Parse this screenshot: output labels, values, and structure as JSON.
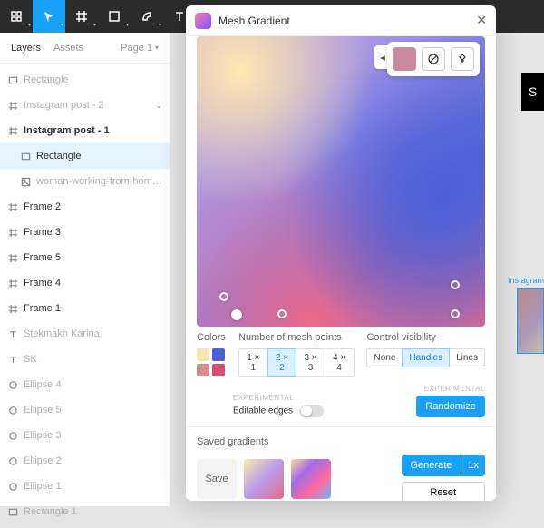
{
  "toolbar": {
    "tools": [
      "figma",
      "move",
      "frame",
      "shape",
      "pen",
      "text"
    ]
  },
  "leftPanel": {
    "tabs": [
      "Layers",
      "Assets"
    ],
    "page": "Page 1",
    "layers": [
      {
        "icon": "rect",
        "label": "Rectangle",
        "indent": 0,
        "dim": true
      },
      {
        "icon": "frame",
        "label": "Instagram post - 2",
        "indent": 0,
        "dim": true,
        "expand": true
      },
      {
        "icon": "frame",
        "label": "Instagram post - 1",
        "indent": 0,
        "bold": true
      },
      {
        "icon": "rect",
        "label": "Rectangle",
        "indent": 1,
        "sel": true
      },
      {
        "icon": "image",
        "label": "woman-working-from-home-l...",
        "indent": 1,
        "dim": true
      },
      {
        "icon": "frame",
        "label": "Frame 2",
        "indent": 0
      },
      {
        "icon": "frame",
        "label": "Frame 3",
        "indent": 0
      },
      {
        "icon": "frame",
        "label": "Frame 5",
        "indent": 0
      },
      {
        "icon": "frame",
        "label": "Frame 4",
        "indent": 0
      },
      {
        "icon": "frame",
        "label": "Frame 1",
        "indent": 0
      },
      {
        "icon": "text",
        "label": "Stekmakh Karina",
        "indent": 0,
        "dim": true
      },
      {
        "icon": "text",
        "label": "SK",
        "indent": 0,
        "dim": true
      },
      {
        "icon": "ellipse",
        "label": "Ellipse 4",
        "indent": 0,
        "dim": true
      },
      {
        "icon": "ellipse",
        "label": "Ellipse 5",
        "indent": 0,
        "dim": true
      },
      {
        "icon": "ellipse",
        "label": "Ellipse 3",
        "indent": 0,
        "dim": true
      },
      {
        "icon": "ellipse",
        "label": "Ellipse 2",
        "indent": 0,
        "dim": true
      },
      {
        "icon": "ellipse",
        "label": "Ellipse 1",
        "indent": 0,
        "dim": true
      },
      {
        "icon": "rect",
        "label": "Rectangle 1",
        "indent": 0,
        "dim": true
      }
    ]
  },
  "plugin": {
    "title": "Mesh Gradient",
    "labels": {
      "colors": "Colors",
      "meshPoints": "Number of mesh points",
      "visibility": "Control visibility",
      "experimental": "EXPERIMENTAL",
      "editableEdges": "Editable edges",
      "randomize": "Randomize",
      "saved": "Saved gradients",
      "save": "Save",
      "generate": "Generate",
      "genCount": "1x",
      "reset": "Reset"
    },
    "swatches": [
      "#f5e6b3",
      "#4d5fd6",
      "#d98b8b",
      "#d9506e"
    ],
    "meshOptions": [
      "1 × 1",
      "2 × 2",
      "3 × 3",
      "4 × 4"
    ],
    "meshSelected": 1,
    "visOptions": [
      "None",
      "Handles",
      "Lines"
    ],
    "visSelected": 1
  },
  "canvas": {
    "thumb1": "S",
    "thumb2Label": "Instagram"
  }
}
